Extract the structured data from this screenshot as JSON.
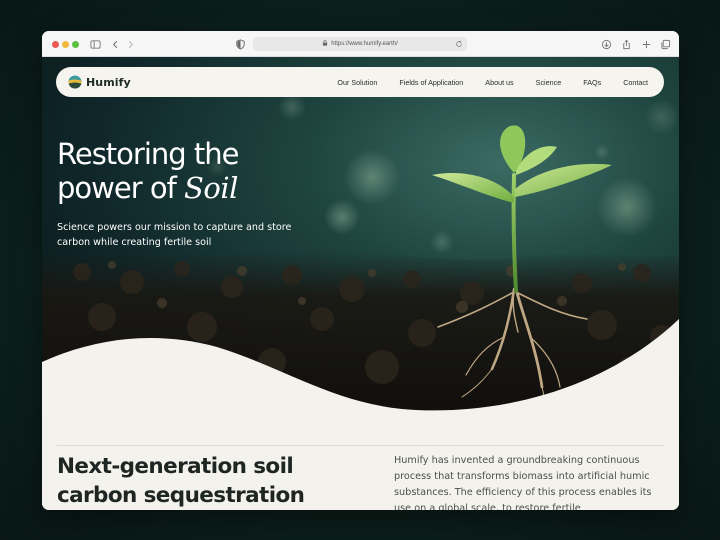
{
  "browser": {
    "url": "https://www.humify.earth/"
  },
  "nav": {
    "brand": "Humify",
    "links": [
      {
        "label": "Our Solution"
      },
      {
        "label": "Fields of Application"
      },
      {
        "label": "About us"
      },
      {
        "label": "Science"
      },
      {
        "label": "FAQs"
      },
      {
        "label": "Contact"
      }
    ]
  },
  "hero": {
    "title_line1": "Restoring the",
    "title_line2_prefix": "power of ",
    "title_line2_accent": "Soil",
    "subtitle": "Science powers our mission to capture and store carbon while creating fertile soil"
  },
  "section": {
    "title": "Next-generation soil carbon sequestration",
    "body": "Humify has invented a groundbreaking continuous process that transforms biomass into artificial humic substances. The efficiency of this process enables its use on a global scale, to restore fertile"
  },
  "colors": {
    "page_background": "#0e2420",
    "navbar_background": "#f6f4ef",
    "content_background": "#f4f2ec",
    "hero_text": "#ffffff",
    "leaf_green": "#8fc75a"
  },
  "icons": [
    "sidebar-toggle-icon",
    "back-arrow-icon",
    "forward-arrow-icon",
    "shield-icon",
    "lock-icon",
    "reload-icon",
    "download-icon",
    "share-icon",
    "new-tab-icon",
    "tabs-overview-icon"
  ]
}
